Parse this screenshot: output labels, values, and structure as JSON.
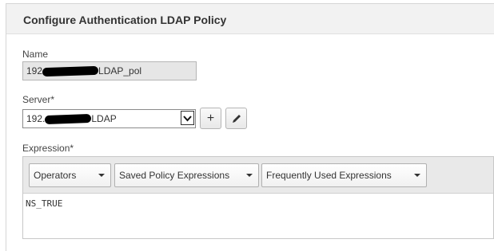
{
  "panel": {
    "title": "Configure Authentication LDAP Policy"
  },
  "name_field": {
    "label": "Name",
    "value_prefix": "192",
    "value_suffix": "LDAP_pol"
  },
  "server_field": {
    "label": "Server*",
    "value_prefix": "192.",
    "value_suffix": "LDAP"
  },
  "buttons": {
    "add_icon": "plus-icon",
    "edit_icon": "pencil-icon",
    "add_glyph": "+"
  },
  "expression": {
    "label": "Expression*",
    "dropdowns": [
      "Operators",
      "Saved Policy Expressions",
      "Frequently Used Expressions"
    ],
    "text": "NS_TRUE"
  },
  "colors": {
    "header_bg": "#f2f2f2",
    "toolbar_bg": "#e9e9e9",
    "readonly_bg": "#e6e6e6"
  }
}
